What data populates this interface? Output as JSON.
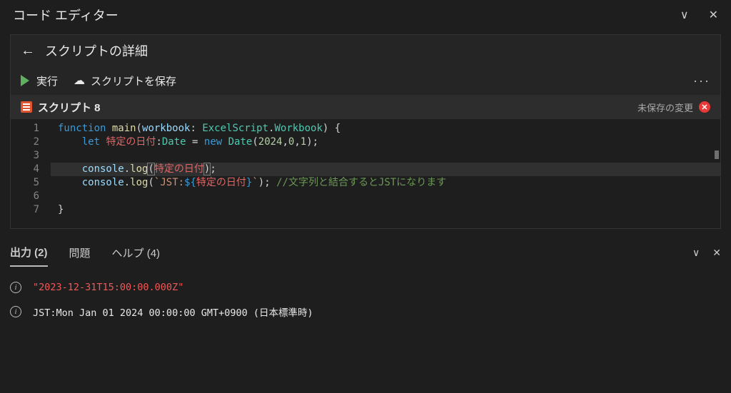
{
  "titlebar": {
    "title": "コード エディター"
  },
  "header": {
    "details_title": "スクリプトの詳細"
  },
  "toolbar": {
    "run_label": "実行",
    "save_label": "スクリプトを保存"
  },
  "script_bar": {
    "name": "スクリプト 8",
    "unsaved_label": "未保存の変更",
    "error_glyph": "✕"
  },
  "code": {
    "line_numbers": [
      "1",
      "2",
      "3",
      "4",
      "5",
      "6",
      "7"
    ],
    "lines": [
      {
        "indent": 0,
        "segments": [
          {
            "t": "function ",
            "c": "tk-keyword"
          },
          {
            "t": "main",
            "c": "tk-func"
          },
          {
            "t": "(",
            "c": "tk-plain"
          },
          {
            "t": "workbook",
            "c": "tk-param"
          },
          {
            "t": ": ",
            "c": "tk-plain"
          },
          {
            "t": "ExcelScript",
            "c": "tk-type"
          },
          {
            "t": ".",
            "c": "tk-plain"
          },
          {
            "t": "Workbook",
            "c": "tk-type"
          },
          {
            "t": ") {",
            "c": "tk-plain"
          }
        ]
      },
      {
        "indent": 1,
        "segments": [
          {
            "t": "let ",
            "c": "tk-keyword"
          },
          {
            "t": "特定の日付",
            "c": "tk-var"
          },
          {
            "t": ":",
            "c": "tk-plain"
          },
          {
            "t": "Date",
            "c": "tk-type"
          },
          {
            "t": " = ",
            "c": "tk-plain"
          },
          {
            "t": "new ",
            "c": "tk-keyword"
          },
          {
            "t": "Date",
            "c": "tk-type"
          },
          {
            "t": "(",
            "c": "tk-plain"
          },
          {
            "t": "2024",
            "c": "tk-num"
          },
          {
            "t": ",",
            "c": "tk-plain"
          },
          {
            "t": "0",
            "c": "tk-num"
          },
          {
            "t": ",",
            "c": "tk-plain"
          },
          {
            "t": "1",
            "c": "tk-num"
          },
          {
            "t": ");",
            "c": "tk-plain"
          }
        ]
      },
      {
        "indent": 0,
        "segments": []
      },
      {
        "indent": 1,
        "highlight": true,
        "segments": [
          {
            "t": "console",
            "c": "tk-param"
          },
          {
            "t": ".",
            "c": "tk-plain"
          },
          {
            "t": "log",
            "c": "tk-func"
          },
          {
            "t": "(",
            "c": "tk-plain tk-bracket-match"
          },
          {
            "t": "特定の日付",
            "c": "tk-var"
          },
          {
            "t": ")",
            "c": "tk-plain tk-bracket-match"
          },
          {
            "t": ";",
            "c": "tk-plain"
          }
        ]
      },
      {
        "indent": 1,
        "segments": [
          {
            "t": "console",
            "c": "tk-param"
          },
          {
            "t": ".",
            "c": "tk-plain"
          },
          {
            "t": "log",
            "c": "tk-func"
          },
          {
            "t": "(",
            "c": "tk-plain"
          },
          {
            "t": "`JST:",
            "c": "tk-string"
          },
          {
            "t": "${",
            "c": "tk-keyword"
          },
          {
            "t": "特定の日付",
            "c": "tk-var"
          },
          {
            "t": "}",
            "c": "tk-keyword"
          },
          {
            "t": "`",
            "c": "tk-string"
          },
          {
            "t": "); ",
            "c": "tk-plain"
          },
          {
            "t": "//文字列と結合するとJSTになります",
            "c": "tk-comment"
          }
        ]
      },
      {
        "indent": 0,
        "segments": []
      },
      {
        "indent": 0,
        "segments": [
          {
            "t": "}",
            "c": "tk-plain"
          }
        ]
      }
    ]
  },
  "bottom_tabs": {
    "output": "出力 (2)",
    "problems": "問題",
    "help": "ヘルプ (4)"
  },
  "output": {
    "line1": "\"2023-12-31T15:00:00.000Z\"",
    "line2": "JST:Mon Jan 01 2024 00:00:00 GMT+0900 (日本標準時)"
  }
}
